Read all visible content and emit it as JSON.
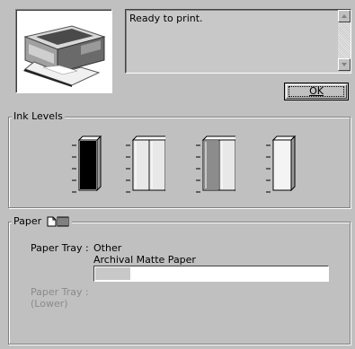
{
  "status": {
    "message": "Ready to print."
  },
  "ok_button": {
    "label": "OK"
  },
  "ink_levels": {
    "title": "Ink Levels",
    "cartridges": [
      {
        "name": "black-cartridge",
        "colors": [
          "#000000"
        ],
        "level": 1.0
      },
      {
        "name": "color-cartridge-1",
        "colors": [
          "#e8e8e8",
          "#e8e8e8"
        ],
        "level": 1.0
      },
      {
        "name": "color-cartridge-2",
        "colors": [
          "#8c8c8c",
          "#e8e8e8"
        ],
        "level": 1.0
      },
      {
        "name": "light-cartridge",
        "colors": [
          "#f4f4f4"
        ],
        "level": 1.0
      }
    ]
  },
  "paper": {
    "title": "Paper",
    "tray_label": "Paper Tray :",
    "tray_value": "Other",
    "paper_type": "Archival Matte Paper",
    "paper_level": 0.15,
    "lower_tray_label_line1": "Paper Tray :",
    "lower_tray_label_line2": "(Lower)"
  }
}
